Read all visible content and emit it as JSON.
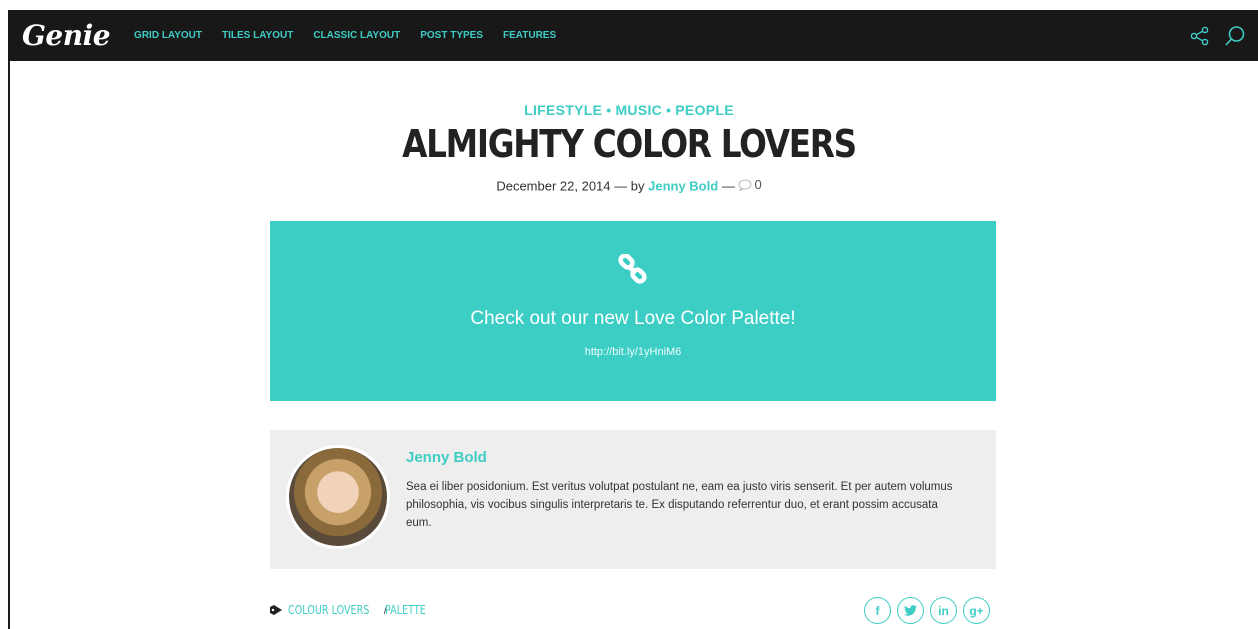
{
  "site": {
    "logo": "Genie"
  },
  "nav": {
    "items": [
      {
        "label": "GRID LAYOUT"
      },
      {
        "label": "TILES LAYOUT"
      },
      {
        "label": "CLASSIC LAYOUT"
      },
      {
        "label": "POST TYPES"
      },
      {
        "label": "FEATURES"
      }
    ],
    "icons": [
      "share-icon",
      "search-icon"
    ]
  },
  "post": {
    "categories": [
      "LIFESTYLE",
      "MUSIC",
      "PEOPLE"
    ],
    "separator": "•",
    "title": "ALMIGHTY COLOR LOVERS",
    "date": "December 22, 2014",
    "by": "— by",
    "dash": "—",
    "author": "Jenny Bold",
    "comment_count": "0"
  },
  "link_box": {
    "icon": "chain-link-icon",
    "title": "Check out our new Love Color Palette!",
    "url": "http://bit.ly/1yHniM6"
  },
  "author_box": {
    "name": "Jenny Bold",
    "bio": "Sea ei liber posidonium. Est veritus volutpat postulant ne, eam ea justo viris senserit. Et per autem volumus philosophia, vis vocibus singulis interpretaris te. Ex disputando referrentur duo, et erant possim accusata eum."
  },
  "tags": {
    "items": [
      "COLOUR LOVERS",
      "PALETTE"
    ],
    "separator": "/"
  },
  "share": {
    "facebook": "f",
    "twitter": "twitter-icon",
    "linkedin": "in",
    "googleplus": "g+"
  },
  "colors": {
    "accent": "#3ecdc5",
    "topbar": "#181818",
    "author_bg": "#eeeeee"
  }
}
